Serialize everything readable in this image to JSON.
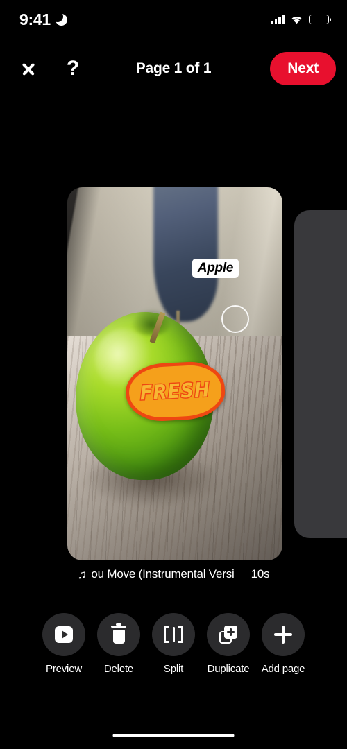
{
  "status_bar": {
    "time": "9:41",
    "dnd_icon": "crescent-moon-icon",
    "signal_icon": "cellular-signal-icon",
    "wifi_icon": "wifi-icon",
    "battery_icon": "battery-full-icon"
  },
  "header": {
    "close_icon": "close-x-icon",
    "help_icon": "?",
    "title": "Page 1 of 1",
    "next_label": "Next",
    "next_color": "#E8102E"
  },
  "canvas": {
    "page_card": {
      "text_sticker": "Apple",
      "graphic_sticker": "FRESH",
      "handle_icon": "selection-ring-handle"
    },
    "next_page_placeholder_color": "#39393c"
  },
  "sound": {
    "note_icon": "♫",
    "title": "ou Move (Instrumental Versi",
    "duration": "10s"
  },
  "toolbar": {
    "items": [
      {
        "label": "Preview",
        "icon": "play-button-icon"
      },
      {
        "label": "Delete",
        "icon": "trash-icon"
      },
      {
        "label": "Split",
        "icon": "split-brackets-icon"
      },
      {
        "label": "Duplicate",
        "icon": "duplicate-pages-icon"
      },
      {
        "label": "Add page",
        "icon": "plus-icon"
      }
    ]
  },
  "home_indicator": "home-bar"
}
